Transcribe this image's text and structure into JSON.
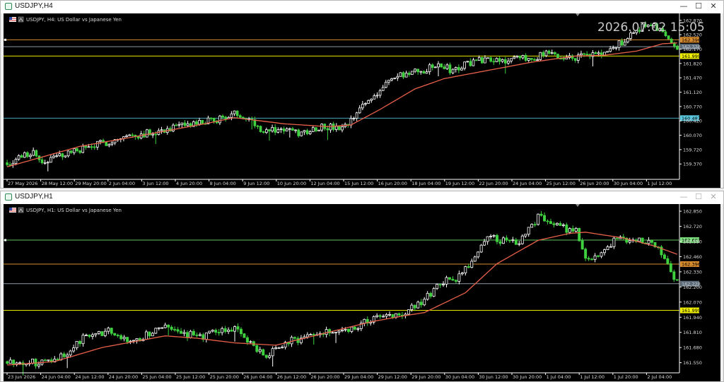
{
  "windows": [
    {
      "title": "USDJPY,H4",
      "subtitle": "USDJPY, H4:  US Dollar vs Japanese Yen",
      "clock": "2026.07.02 15:05",
      "chart_data": {
        "type": "candlestick",
        "symbol": "USDJPY",
        "timeframe": "H4",
        "title": "USDJPY, H4:  US Dollar vs Japanese Yen",
        "ylim": [
          159.03,
          162.97
        ],
        "y_ticks": [
          "162.870",
          "162.520",
          "162.170",
          "161.820",
          "161.470",
          "161.120",
          "160.770",
          "160.420",
          "160.070",
          "159.720",
          "159.370"
        ],
        "x_ticks": [
          "27 May 2026",
          "28 May 12:00",
          "29 May 20:00",
          "2 Jun 04:00",
          "3 Jun 12:00",
          "4 Jun 20:00",
          "8 Jun 04:00",
          "9 Jun 12:00",
          "10 Jun 20:00",
          "12 Jun 04:00",
          "15 Jun 12:00",
          "16 Jun 20:00",
          "18 Jun 04:00",
          "19 Jun 12:00",
          "22 Jun 20:00",
          "24 Jun 04:00",
          "25 Jun 12:00",
          "26 Jun 20:00",
          "30 Jun 04:00",
          "1 Jul 12:00"
        ],
        "levels": [
          {
            "price": 162.396,
            "label": "162.396",
            "color": "#d98c2b",
            "label_bg": "#d98c2b",
            "label_color": "#000000"
          },
          {
            "price": 162.228,
            "label": "162.228",
            "color": "#8a9aa8",
            "label_bg": "#5d6b78",
            "label_color": "#c8d0d8"
          },
          {
            "price": 161.999,
            "label": "161.999",
            "color": "#e6e600",
            "label_bg": "#f0f000",
            "label_color": "#000000"
          },
          {
            "price": 160.487,
            "label": "160.487",
            "color": "#4aa6b8",
            "label_bg": "#5bc8e0",
            "label_color": "#000000"
          }
        ],
        "ma_anchors": [
          [
            0,
            159.3
          ],
          [
            10,
            159.5
          ],
          [
            25,
            159.8
          ],
          [
            45,
            160.05
          ],
          [
            70,
            160.38
          ],
          [
            78,
            160.5
          ],
          [
            95,
            160.35
          ],
          [
            110,
            160.28
          ],
          [
            118,
            160.32
          ],
          [
            128,
            160.7
          ],
          [
            140,
            161.2
          ],
          [
            150,
            161.45
          ],
          [
            165,
            161.65
          ],
          [
            180,
            161.85
          ],
          [
            195,
            162.0
          ],
          [
            205,
            162.02
          ],
          [
            216,
            162.12
          ],
          [
            225,
            162.3
          ],
          [
            230,
            162.32
          ]
        ],
        "close_anchors": [
          [
            0,
            159.4
          ],
          [
            9,
            159.68
          ],
          [
            12,
            159.42
          ],
          [
            20,
            159.62
          ],
          [
            28,
            159.78
          ],
          [
            40,
            160.02
          ],
          [
            55,
            160.22
          ],
          [
            70,
            160.42
          ],
          [
            78,
            160.58
          ],
          [
            82,
            160.55
          ],
          [
            88,
            160.18
          ],
          [
            95,
            160.22
          ],
          [
            100,
            160.1
          ],
          [
            108,
            160.3
          ],
          [
            115,
            160.2
          ],
          [
            118,
            160.4
          ],
          [
            122,
            160.8
          ],
          [
            126,
            161.05
          ],
          [
            131,
            161.4
          ],
          [
            136,
            161.55
          ],
          [
            142,
            161.62
          ],
          [
            148,
            161.78
          ],
          [
            153,
            161.65
          ],
          [
            160,
            161.88
          ],
          [
            166,
            161.95
          ],
          [
            172,
            161.9
          ],
          [
            180,
            161.95
          ],
          [
            185,
            162.05
          ],
          [
            190,
            161.95
          ],
          [
            198,
            162.0
          ],
          [
            206,
            162.08
          ],
          [
            210,
            162.3
          ],
          [
            214,
            162.5
          ],
          [
            218,
            162.75
          ],
          [
            222,
            162.72
          ],
          [
            226,
            162.55
          ],
          [
            230,
            162.2
          ]
        ],
        "candle_count": 231,
        "seed": 7,
        "bull_color": "#ffffff",
        "bear_color": "#3fd13f",
        "ma_color": "#e8604a"
      }
    },
    {
      "title": "USDJPY,H1",
      "subtitle": "USDJPY, H1:  US Dollar vs Japanese Yen",
      "chart_data": {
        "type": "candlestick",
        "symbol": "USDJPY",
        "timeframe": "H1",
        "title": "USDJPY, H1:  US Dollar vs Japanese Yen",
        "ylim": [
          161.475,
          162.875
        ],
        "y_ticks": [
          "162.850",
          "162.720",
          "162.590",
          "162.460",
          "162.330",
          "162.200",
          "162.070",
          "161.940",
          "161.810",
          "161.680",
          "161.550"
        ],
        "x_ticks": [
          "23 Jun 2026",
          "24 Jun 04:00",
          "24 Jun 12:00",
          "24 Jun 20:00",
          "25 Jun 04:00",
          "25 Jun 12:00",
          "25 Jun 20:00",
          "26 Jun 04:00",
          "26 Jun 12:00",
          "26 Jun 20:00",
          "29 Jun 04:00",
          "29 Jun 12:00",
          "29 Jun 20:00",
          "30 Jun 04:00",
          "30 Jun 12:00",
          "30 Jun 20:00",
          "1 Jul 04:00",
          "1 Jul 12:00",
          "1 Jul 20:00",
          "2 Jul 04:00"
        ],
        "levels": [
          {
            "price": 162.602,
            "label": "162.602",
            "color": "#5ec45e",
            "label_bg": "#7fe07f",
            "label_color": "#000000"
          },
          {
            "price": 162.396,
            "label": "162.396",
            "color": "#d98c2b",
            "label_bg": "#d98c2b",
            "label_color": "#000000"
          },
          {
            "price": 162.228,
            "label": "162.228",
            "color": "#8a9aa8",
            "label_bg": "#5d6b78",
            "label_color": "#c8d0d8"
          },
          {
            "price": 161.999,
            "label": "161.999",
            "color": "#e6e600",
            "label_bg": "#f0f000",
            "label_color": "#000000"
          }
        ],
        "ma_anchors": [
          [
            0,
            161.53
          ],
          [
            15,
            161.56
          ],
          [
            30,
            161.68
          ],
          [
            50,
            161.78
          ],
          [
            60,
            161.76
          ],
          [
            72,
            161.72
          ],
          [
            85,
            161.7
          ],
          [
            100,
            161.8
          ],
          [
            115,
            161.9
          ],
          [
            125,
            161.95
          ],
          [
            132,
            161.98
          ],
          [
            145,
            162.15
          ],
          [
            155,
            162.4
          ],
          [
            168,
            162.6
          ],
          [
            178,
            162.66
          ],
          [
            183,
            162.67
          ],
          [
            195,
            162.62
          ],
          [
            205,
            162.55
          ],
          [
            212,
            162.48
          ]
        ],
        "close_anchors": [
          [
            0,
            161.56
          ],
          [
            10,
            161.55
          ],
          [
            18,
            161.62
          ],
          [
            25,
            161.78
          ],
          [
            32,
            161.82
          ],
          [
            40,
            161.72
          ],
          [
            48,
            161.86
          ],
          [
            55,
            161.8
          ],
          [
            62,
            161.78
          ],
          [
            72,
            161.84
          ],
          [
            78,
            161.68
          ],
          [
            82,
            161.62
          ],
          [
            90,
            161.74
          ],
          [
            100,
            161.8
          ],
          [
            110,
            161.86
          ],
          [
            118,
            161.95
          ],
          [
            125,
            161.98
          ],
          [
            131,
            162.06
          ],
          [
            134,
            162.15
          ],
          [
            138,
            162.25
          ],
          [
            142,
            162.25
          ],
          [
            147,
            162.42
          ],
          [
            152,
            162.62
          ],
          [
            157,
            162.6
          ],
          [
            162,
            162.58
          ],
          [
            168,
            162.8
          ],
          [
            173,
            162.72
          ],
          [
            180,
            162.68
          ],
          [
            183,
            162.42
          ],
          [
            188,
            162.5
          ],
          [
            193,
            162.62
          ],
          [
            198,
            162.6
          ],
          [
            204,
            162.58
          ],
          [
            208,
            162.45
          ],
          [
            212,
            162.23
          ]
        ],
        "candle_count": 213,
        "seed": 11,
        "bull_color": "#ffffff",
        "bear_color": "#3fd13f",
        "ma_color": "#e8604a"
      }
    }
  ]
}
